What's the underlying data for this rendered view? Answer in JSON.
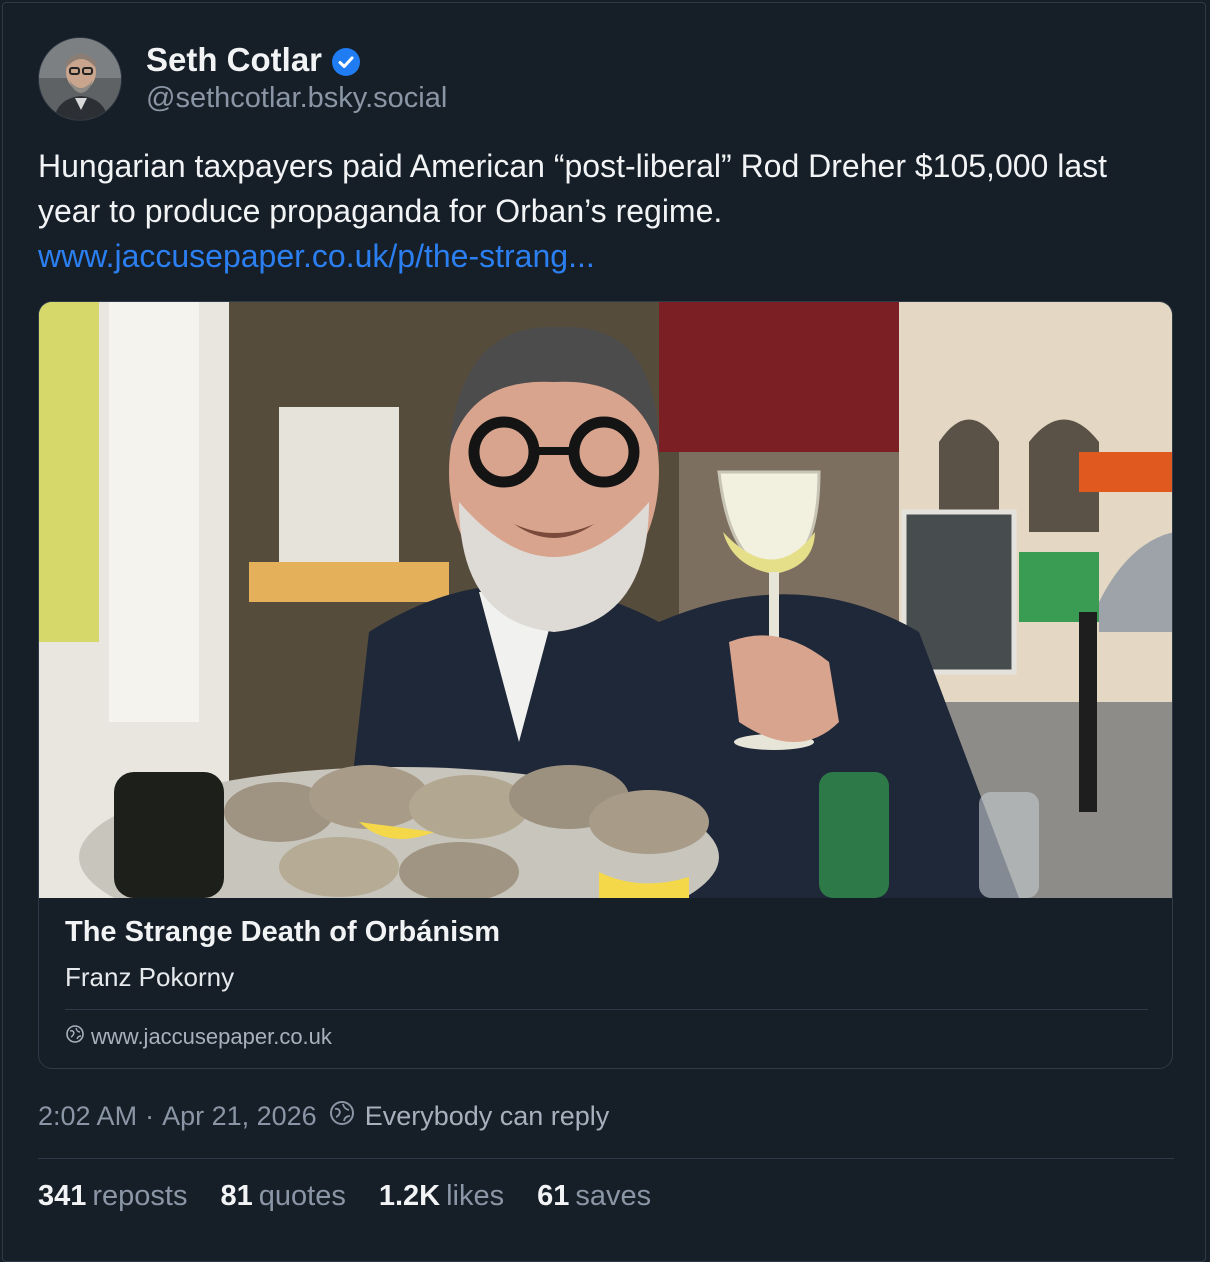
{
  "author": {
    "display_name": "Seth Cotlar",
    "handle": "@sethcotlar.bsky.social",
    "verified": true,
    "verified_color": "#1f7cf2"
  },
  "post": {
    "text": "Hungarian taxpayers paid American “post-liberal” Rod Dreher $105,000 last year to produce propaganda for Orban’s regime.",
    "link_text": "www.jaccusepaper.co.uk/p/the-strang..."
  },
  "embed": {
    "title": "The Strange Death of Orbánism",
    "author": "Franz Pokorny",
    "domain": "www.jaccusepaper.co.uk"
  },
  "meta": {
    "time": "2:02 AM",
    "separator": "·",
    "date": "Apr 21, 2026",
    "reply_setting": "Everybody can reply"
  },
  "stats": {
    "reposts_count": "341",
    "reposts_label": "reposts",
    "quotes_count": "81",
    "quotes_label": "quotes",
    "likes_count": "1.2K",
    "likes_label": "likes",
    "saves_count": "61",
    "saves_label": "saves"
  },
  "colors": {
    "background": "#161e27",
    "link": "#2b7ff0",
    "muted": "#8a96a5",
    "border": "#2e3a48"
  }
}
